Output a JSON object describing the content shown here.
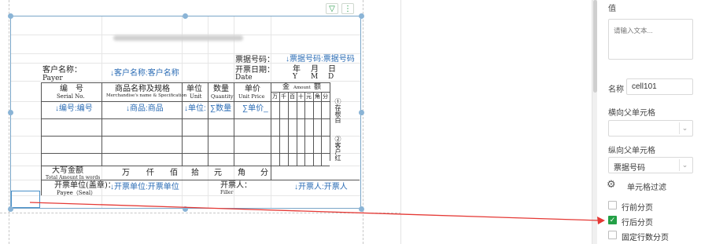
{
  "canvas": {
    "tools": {
      "filter_icon": "funnel-icon",
      "more_icon": "vertical-dots-icon"
    },
    "invoice": {
      "title_blurred": "",
      "receipt_no_label": "票据号码：",
      "receipt_no_bind": "↓票据号码:票据号码",
      "customer_label_cn": "客户名称：",
      "customer_label_en": "Payer",
      "customer_bind": "↓客户名称:客户名称",
      "date_label_cn": "开票日期：",
      "date_label_en": "Date",
      "date_year": "年",
      "date_month": "月",
      "date_day": "日",
      "date_y": "Y",
      "date_m": "M",
      "date_d": "D",
      "col_serial_cn": "编　号",
      "col_serial_en": "Serial No.",
      "col_goods_cn": "商品名称及规格",
      "col_goods_en": "Merchandise's name & Specification",
      "col_unit_cn": "单位",
      "col_unit_en": "Unit",
      "col_qty_cn": "数量",
      "col_qty_en": "Quantity",
      "col_price_cn": "单价",
      "col_price_en": "Unit Price",
      "col_amount_cn1": "金",
      "col_amount_en": "Amount",
      "col_amount_cn2": "额",
      "amount_digits": [
        "万",
        "千",
        "百",
        "十",
        "元",
        "角",
        "分"
      ],
      "bind_serial": "↓编号:编号",
      "bind_goods": "↓商品:商品",
      "bind_unit": "↓单位:",
      "bind_qty": "∑数量",
      "bind_price": "∑单价_",
      "side_note_1": "①存根白",
      "side_note_2": "②客户红",
      "total_cn": "大写金额",
      "total_en": "Total Amount In words",
      "total_units": [
        "万",
        "仟",
        "佰",
        "拾",
        "元",
        "角",
        "分"
      ],
      "payee_label_cn": "开票单位(盖章)：",
      "payee_label_en": "Payee（Seal）",
      "payee_bind": "↓开票单位:开票单位",
      "filler_label_cn": "开票人：",
      "filler_label_en": "Filler",
      "filler_bind": "↓开票人:开票人"
    }
  },
  "panel": {
    "value_label": "值",
    "value_placeholder": "请输入文本...",
    "name_label": "名称",
    "name_value": "cell101",
    "h_parent_label": "横向父单元格",
    "h_parent_value": "",
    "v_parent_label": "纵向父单元格",
    "v_parent_value": "票据号码",
    "filter_label": "单元格过滤",
    "checkboxes": [
      {
        "label": "行前分页",
        "checked": false
      },
      {
        "label": "行后分页",
        "checked": true
      },
      {
        "label": "固定行数分页",
        "checked": false
      }
    ],
    "check_color": "#23a046",
    "arrow_color": "#e53935"
  }
}
